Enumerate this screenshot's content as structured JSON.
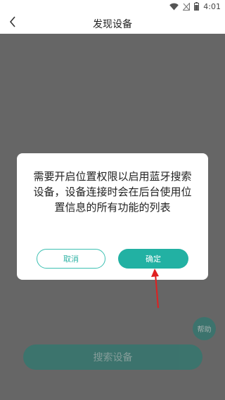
{
  "status_bar": {
    "time": "4:01",
    "icons": [
      "wifi-icon",
      "signal-off-icon",
      "battery-icon"
    ]
  },
  "header": {
    "back_icon": "chevron-left-icon",
    "title": "发现设备"
  },
  "background": {
    "help_label": "帮助",
    "search_button_label": "搜索设备"
  },
  "dialog": {
    "message": "需要开启位置权限以启用蓝牙搜索设备，设备连接时会在后台使用位置信息的所有功能的列表",
    "cancel_label": "取消",
    "confirm_label": "确定"
  },
  "annotation": {
    "arrow_color": "#e02020"
  },
  "colors": {
    "accent": "#22b1a3",
    "dark_accent": "#1a7f73",
    "overlay": "rgba(0,0,0,0.6)"
  }
}
